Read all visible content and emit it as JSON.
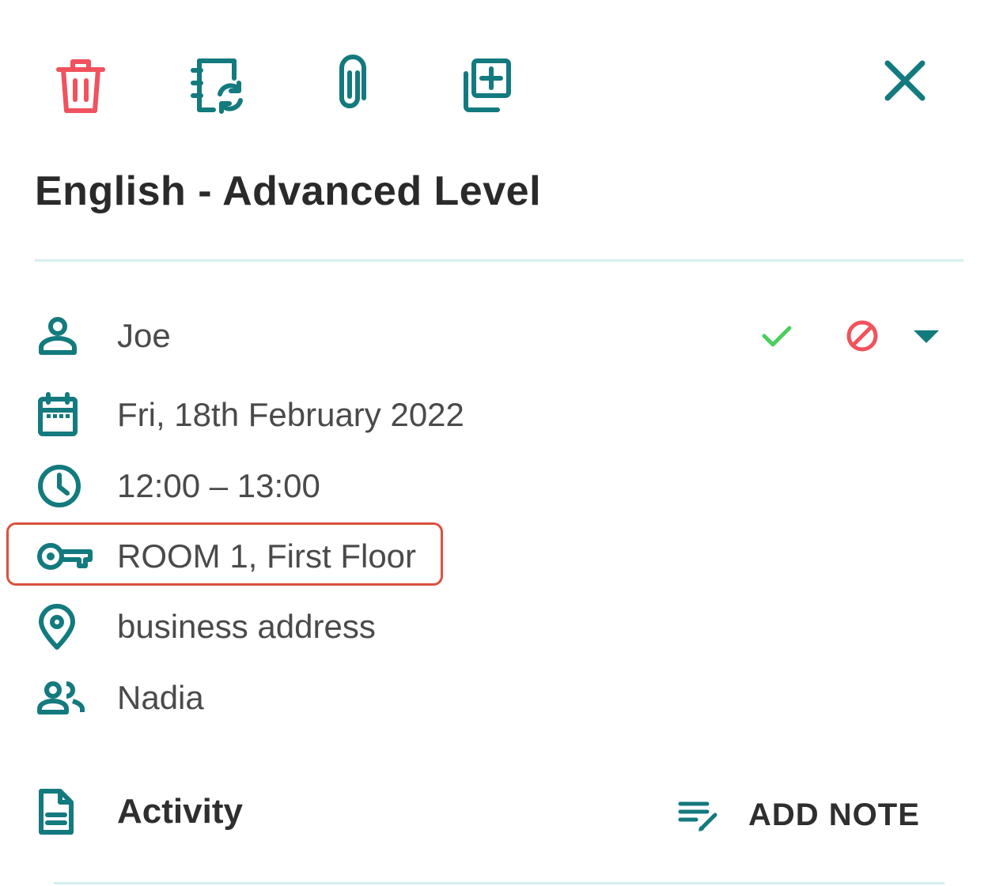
{
  "toolbar": {
    "delete_icon": "trash-icon",
    "reschedule_icon": "notebook-sync-icon",
    "attach_icon": "paperclip-icon",
    "duplicate_icon": "duplicate-plus-icon",
    "close_icon": "close-icon"
  },
  "event": {
    "title": "English - Advanced Level"
  },
  "details": {
    "teacher": "Joe",
    "date": "Fri, 18th February 2022",
    "time": "12:00 – 13:00",
    "room": "ROOM 1, First Floor",
    "location": "business address",
    "attendees": "Nadia"
  },
  "status": {
    "confirm_icon": "check-icon",
    "cancel_icon": "block-icon",
    "menu_icon": "caret-down-icon"
  },
  "activity": {
    "label": "Activity",
    "add_note_label": "ADD NOTE"
  },
  "colors": {
    "teal": "#137a7e",
    "red": "#f0525e",
    "green": "#4cce5e",
    "highlight": "#d9523e",
    "divider": "#d5eeee"
  }
}
